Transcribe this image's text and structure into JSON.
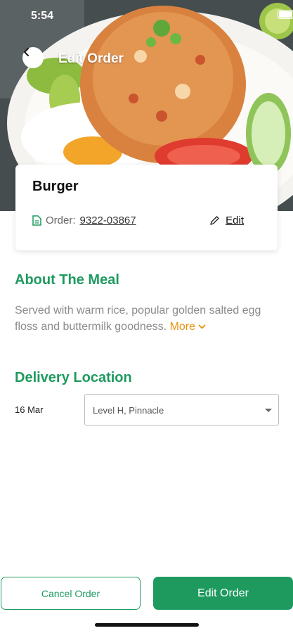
{
  "status": {
    "time": "5:54"
  },
  "header": {
    "title": "Edit Order"
  },
  "order": {
    "item_name": "Burger",
    "order_label": "Order:",
    "order_number": "9322-03867",
    "edit_label": "Edit"
  },
  "about": {
    "title": "About The Meal",
    "description": "Served with warm rice, popular golden salted egg floss and buttermilk goodness.",
    "more_label": "More"
  },
  "delivery": {
    "title": "Delivery Location",
    "date": "16 Mar",
    "location_value": "Level H, Pinnacle"
  },
  "actions": {
    "cancel_label": "Cancel Order",
    "edit_label": "Edit Order"
  },
  "colors": {
    "accent": "#1e9a5f",
    "more_link": "#e8930d"
  }
}
